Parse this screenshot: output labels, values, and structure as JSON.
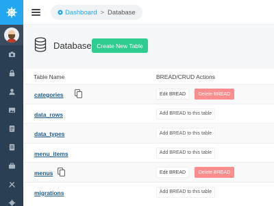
{
  "breadcrumb": {
    "home": "Dashboard",
    "separator": ">",
    "current": "Database"
  },
  "header": {
    "title": "Database",
    "create_button": "Create New Table"
  },
  "table": {
    "col_name": "Table Name",
    "col_actions": "BREAD/CRUD Actions",
    "rows": [
      {
        "name": "categories",
        "edit": "Edit BREAD",
        "delete": "Delete BREAD"
      },
      {
        "name": "data_rows",
        "add": "Add BREAD to this table"
      },
      {
        "name": "data_types",
        "add": "Add BREAD to this table"
      },
      {
        "name": "menu_items",
        "add": "Add BREAD to this table"
      },
      {
        "name": "menus",
        "edit": "Edit BREAD",
        "delete": "Delete BREAD"
      },
      {
        "name": "migrations",
        "add": "Add BREAD to this table"
      }
    ]
  },
  "colors": {
    "accent": "#22a7f0",
    "sidebar": "#2a3f54",
    "create": "#2ecc8e",
    "delete": "#fa8d8d",
    "link": "#1e5b8a"
  }
}
